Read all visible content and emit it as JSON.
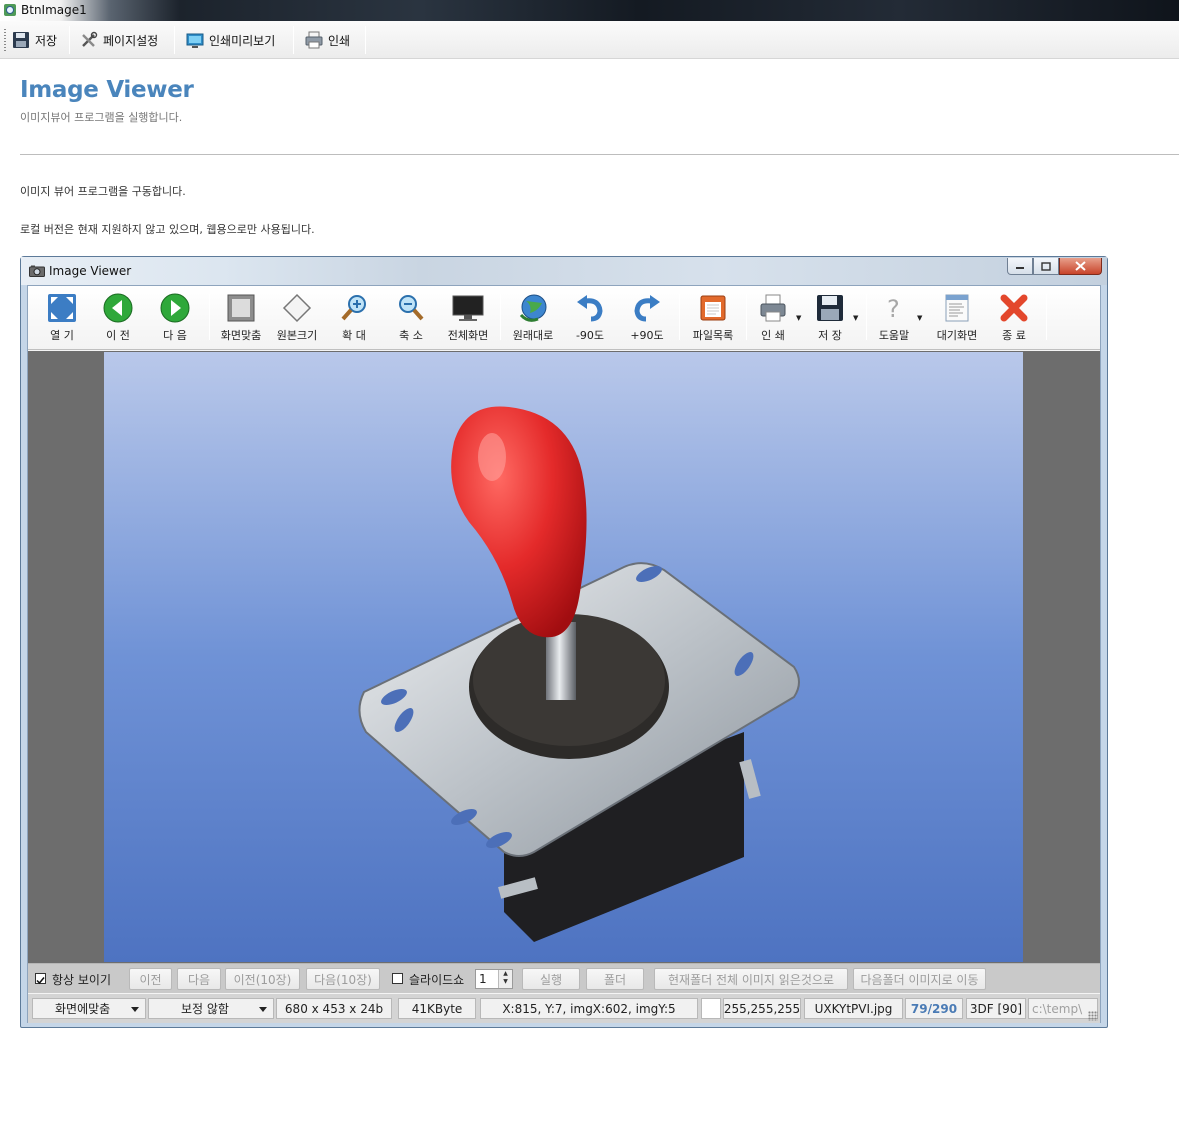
{
  "window": {
    "title": "BtnImage1"
  },
  "toolbar": {
    "save": "저장",
    "page_setup": "페이지설정",
    "print_preview": "인쇄미리보기",
    "print": "인쇄"
  },
  "page": {
    "title": "Image Viewer",
    "subtitle": "이미지뷰어 프로그램을 실행합니다.",
    "para1": "이미지 뷰어 프로그램을 구동합니다.",
    "para2": "로컬 버전은 현재 지원하지 않고 있으며, 웹용으로만 사용됩니다."
  },
  "viewer": {
    "title": "Image Viewer",
    "tools": {
      "open": "열 기",
      "prev": "이 전",
      "next": "다 음",
      "fit": "화면맞춤",
      "original": "원본크기",
      "zoom_in": "확 대",
      "zoom_out": "축 소",
      "fullscreen": "전체화면",
      "restore": "원래대로",
      "rotate_left": "-90도",
      "rotate_right": "+90도",
      "file_list": "파일목록",
      "print": "인 쇄",
      "save": "저 장",
      "help": "도움말",
      "standby": "대기화면",
      "exit": "종 료"
    },
    "controls": {
      "always_show": "항상 보이기",
      "prev": "이전",
      "next": "다음",
      "prev10": "이전(10장)",
      "next10": "다음(10장)",
      "slideshow": "슬라이드쇼",
      "slide_value": "1",
      "run": "실행",
      "folder": "폴더",
      "read_all": "현재폴더 전체 이미지 읽은것으로",
      "next_folder": "다음폴더 이미지로 이동"
    },
    "status": {
      "fit_mode": "화면에맞춤",
      "correction": "보정 않함",
      "dimensions": "680 x 453 x 24b",
      "filesize": "41KByte",
      "coords": "X:815, Y:7, imgX:602, imgY:5",
      "rgb": "255,255,255",
      "filename": "UXKYtPVI.jpg",
      "index": "79/290",
      "format": "3DF [90]",
      "path": "c:\\temp\\"
    }
  },
  "colors": {
    "title_blue": "#4a85bc",
    "viewer_frame": "#5d7a99",
    "photo_background": "#5f86c8",
    "knob_red": "#e42a2a"
  }
}
